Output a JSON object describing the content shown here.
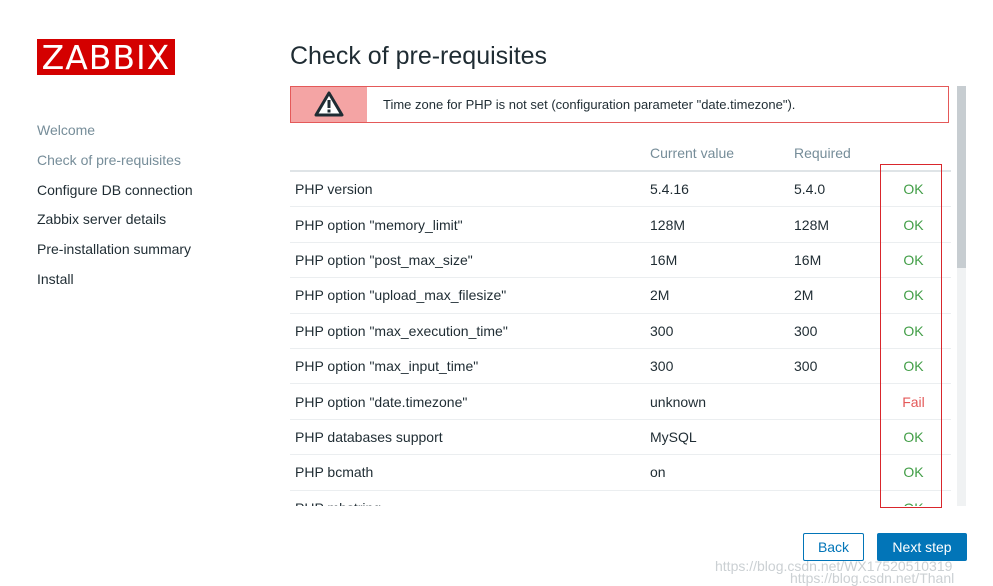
{
  "logo": {
    "text": "ZABBIX"
  },
  "nav": {
    "items": [
      {
        "label": "Welcome"
      },
      {
        "label": "Check of pre-requisites"
      },
      {
        "label": "Configure DB connection"
      },
      {
        "label": "Zabbix server details"
      },
      {
        "label": "Pre-installation summary"
      },
      {
        "label": "Install"
      }
    ]
  },
  "page": {
    "title": "Check of pre-requisites"
  },
  "alert": {
    "message": "Time zone for PHP is not set (configuration parameter \"date.timezone\").",
    "icon": "warning-icon"
  },
  "table": {
    "columns": {
      "name": "",
      "current": "Current value",
      "required": "Required",
      "result": ""
    },
    "rows": [
      {
        "name": "PHP version",
        "current": "5.4.16",
        "required": "5.4.0",
        "result": "OK"
      },
      {
        "name": "PHP option \"memory_limit\"",
        "current": "128M",
        "required": "128M",
        "result": "OK"
      },
      {
        "name": "PHP option \"post_max_size\"",
        "current": "16M",
        "required": "16M",
        "result": "OK"
      },
      {
        "name": "PHP option \"upload_max_filesize\"",
        "current": "2M",
        "required": "2M",
        "result": "OK"
      },
      {
        "name": "PHP option \"max_execution_time\"",
        "current": "300",
        "required": "300",
        "result": "OK"
      },
      {
        "name": "PHP option \"max_input_time\"",
        "current": "300",
        "required": "300",
        "result": "OK"
      },
      {
        "name": "PHP option \"date.timezone\"",
        "current": "unknown",
        "required": "",
        "result": "Fail"
      },
      {
        "name": "PHP databases support",
        "current": "MySQL",
        "required": "",
        "result": "OK"
      },
      {
        "name": "PHP bcmath",
        "current": "on",
        "required": "",
        "result": "OK"
      },
      {
        "name": "PHP mbstring",
        "current": "",
        "required": "",
        "result": "OK"
      }
    ]
  },
  "buttons": {
    "back": "Back",
    "next": "Next step"
  },
  "watermark": {
    "line1": "https://blog.csdn.net/WX17520510319",
    "line2": "https://blog.csdn.net/Thanl"
  },
  "colors": {
    "brand": "#d40000",
    "accent": "#0275b8",
    "ok": "#429e47",
    "fail": "#e45959",
    "alert_border": "#e45959",
    "alert_icon_bg": "#f4a4a4"
  }
}
